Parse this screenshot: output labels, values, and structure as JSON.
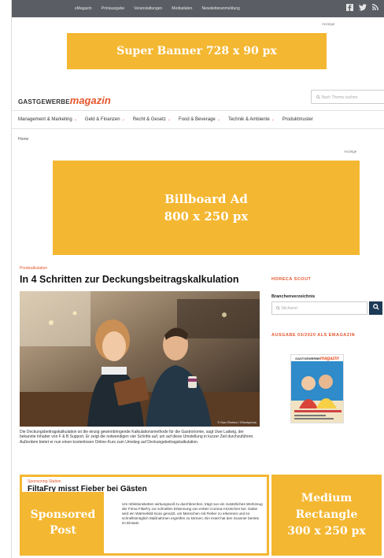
{
  "topbar": {
    "nav": [
      "eMagazin",
      "Printausgabe",
      "Veranstaltungen",
      "Mediadaten",
      "Newsletteranmeldung"
    ],
    "icons": [
      "facebook-icon",
      "twitter-icon",
      "rss-icon"
    ]
  },
  "ads": {
    "anzeige_label": "Anzeige",
    "super_banner": "Super Banner 728 x 90 px",
    "billboard_line1": "Billboard Ad",
    "billboard_line2": "800 x 250 px",
    "medium_rect_line1": "Medium",
    "medium_rect_line2": "Rectangle",
    "medium_rect_line3": "300 x 250 px",
    "sponsored_line1": "Sponsored",
    "sponsored_line2": "Post"
  },
  "header": {
    "logo_prefix": "GASTGEWERBE",
    "logo_mag": "magazin",
    "search_placeholder": "Nach Thema suchen"
  },
  "mainnav": [
    {
      "label": "Management & Marketing",
      "chevron": "⌄"
    },
    {
      "label": "Geld & Finanzen",
      "chevron": "⌄"
    },
    {
      "label": "Recht & Gesetz",
      "chevron": "⌄"
    },
    {
      "label": "Food & Beverage",
      "chevron": "⌄"
    },
    {
      "label": "Technik & Ambiente",
      "chevron": "⌄"
    },
    {
      "label": "Produktmuster",
      "chevron": ""
    }
  ],
  "breadcrumb": "Home",
  "article": {
    "kicker": "Preiskalkulation",
    "title": "In 4 Schritten zur Deckungsbeitragskalkulation",
    "photo_credit": "© Dan Rentea / iStockphoto",
    "lead": "Die Deckungsbeitragskalkulation ist die einzig gewinnbringende Kalkulationsmethode für die Gastronomie, sagt Uwe Ladwig, der bekannte Inhaber von F & B Support. Er zeigt die notwendigen vier Schritte auf, um auf diese Umstellung in kurzer Zeit durchzuführen. Außerdem bietet er nun einen kostenlosen Online-Kurs zum Umstieg auf Deckungsbeitragskalkulation."
  },
  "sidebar": {
    "heading1": "HORECA SCOUT",
    "subheading": "Branchenverzeichnis",
    "search_placeholder": "Stichwort",
    "search_icon": "search-icon",
    "heading2": "AUSGABE 03/2020 ALS EMAGAZIN",
    "cover_prefix": "GASTGEWERBE",
    "cover_mag": "magazin"
  },
  "sponsored": {
    "label": "Sponsoring-Station",
    "title": "FiltaFry misst Fieber bei Gästen",
    "text": "Um Infektionsketten wirkungsvoll zu durchbrechen, trägt nun ein zusätzliches Werkzeug der Firma FiltaFry zur schnellen Erkennung von ersten Corona-Anzeichen bei. Dabei wird ein Wärmebild-Scan genutzt, um Menschen mit Fieber zu erkennen und so schnellstmöglich Maßnahmen ergreifen zu können. Ein Hotel hat den Scanner bereits im Einsatz."
  },
  "colors": {
    "ad_yellow": "#f4b731",
    "brand_orange": "#e4572e",
    "topbar_gray": "#5a5d63",
    "button_navy": "#1d3a57"
  }
}
